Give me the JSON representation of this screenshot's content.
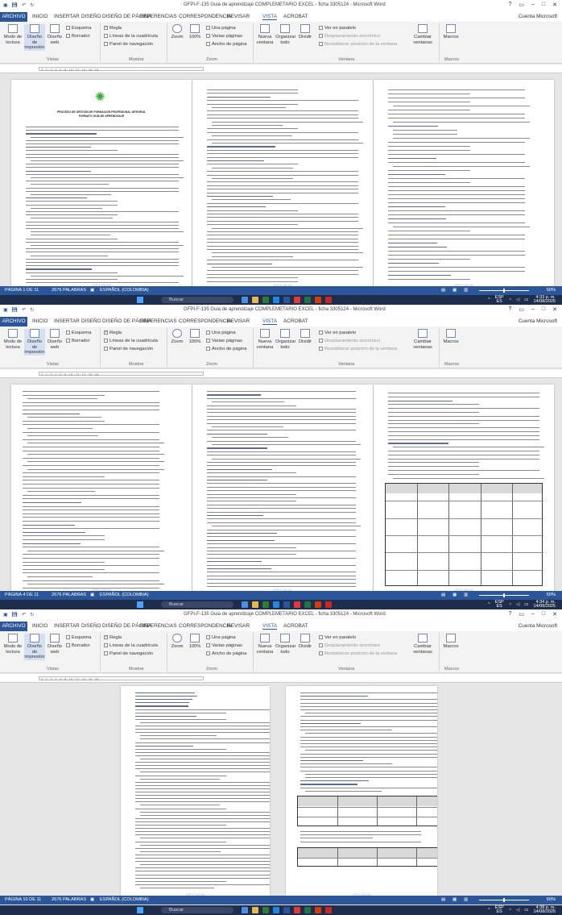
{
  "app": {
    "title": "GFPI-F-135 Guia de aprendizaje COMPLEMETARIO EXCEL - ficha 3305124 - Microsoft Word",
    "account": "Cuenta Microsoft",
    "help": "?",
    "tabs": [
      "ARCHIVO",
      "INICIO",
      "INSERTAR",
      "DISEÑO",
      "DISEÑO DE PÁGINA",
      "REFERENCIAS",
      "CORRESPONDENCIA",
      "REVISAR",
      "VISTA",
      "ACROBAT"
    ],
    "active_tab": "VISTA"
  },
  "ribbon": {
    "vistas": {
      "modo_lectura": "Modo de lectura",
      "diseno_impresion": "Diseño de impresión",
      "diseno_web": "Diseño web",
      "esquema": "Esquema",
      "borrador": "Borrador",
      "group": "Vistas"
    },
    "mostrar": {
      "regla": "Regla",
      "lineas": "Líneas de la cuadrícula",
      "panel": "Panel de navegación",
      "group": "Mostrar"
    },
    "zoom": {
      "zoom": "Zoom",
      "pct": "100%",
      "una_pagina": "Una página",
      "varias_paginas": "Varias páginas",
      "ancho": "Ancho de página",
      "group": "Zoom"
    },
    "ventana": {
      "nueva": "Nueva ventana",
      "organizar": "Organizar todo",
      "dividir": "Dividir",
      "paralelo": "Ver en paralelo",
      "desplazamiento": "Desplazamiento sincrónico",
      "restablecer": "Restablecer posición de la ventana",
      "cambiar": "Cambiar ventanas",
      "group": "Ventana"
    },
    "macros": {
      "macros": "Macros",
      "group": "Macros"
    }
  },
  "ruler_ticks": "2 · 1 · 2 · 4 · 6 · 8 · 10 · 12 · 14 · 16 · 18",
  "screens": [
    {
      "page_info": "PÁGINA 1 DE 11",
      "words": "2676 PALABRAS",
      "lang": "ESPAÑOL (COLOMBIA)",
      "zoom": "50%",
      "time": "4:33 p. m.",
      "date": "14/08/2025"
    },
    {
      "page_info": "PÁGINA 4 DE 11",
      "words": "2676 PALABRAS",
      "lang": "ESPAÑOL (COLOMBIA)",
      "zoom": "50%",
      "time": "4:34 p. m.",
      "date": "14/08/2025"
    },
    {
      "page_info": "PÁGINA 10 DE 11",
      "words": "2676 PALABRAS",
      "lang": "ESPAÑOL (COLOMBIA)",
      "zoom": "50%",
      "time": "4:38 p. m.",
      "date": "14/08/2025"
    }
  ],
  "taskbar": {
    "search": "Buscar",
    "lang": "ESP",
    "lang2": "ES"
  },
  "doc": {
    "heading": "PROCESO DE GESTIÓN DE FORMACIÓN PROFESIONAL INTEGRAL",
    "subheading": "FORMATO GUÍA DE APRENDIZAJE",
    "footer": "GFPI-F-135 V04"
  },
  "colors": {
    "accent": "#2b579a",
    "logo": "#39a935"
  }
}
